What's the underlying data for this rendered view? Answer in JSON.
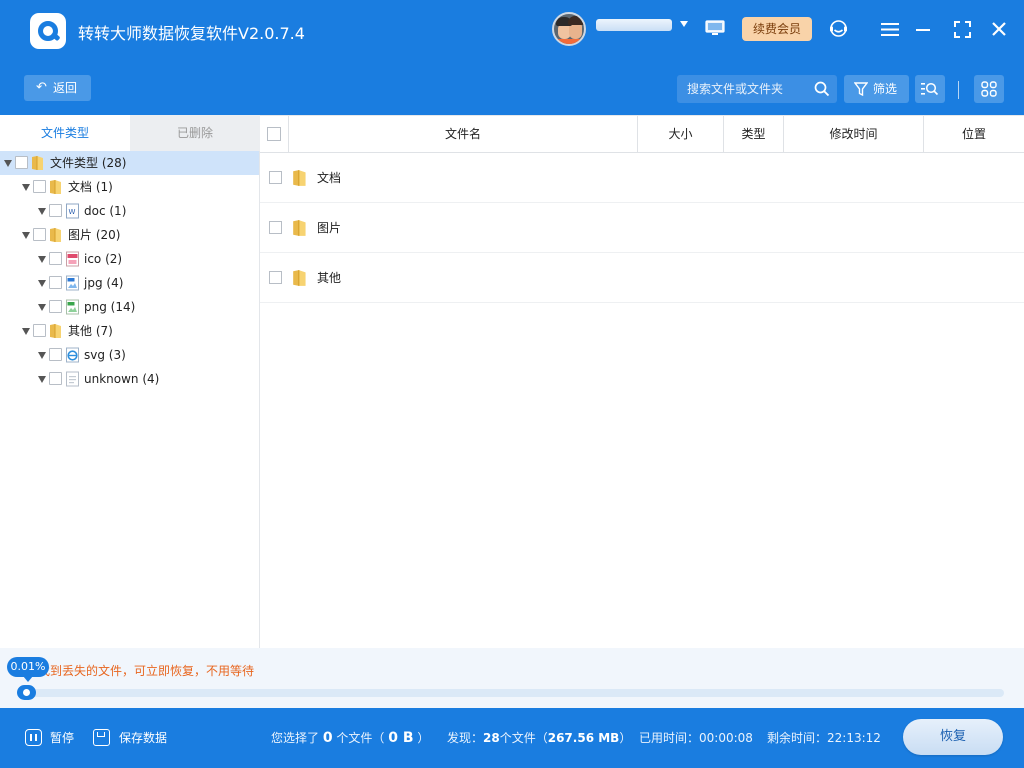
{
  "app": {
    "title": "转转大师数据恢复软件V2.0.7.4",
    "vip_label": "续费会员"
  },
  "toolbar": {
    "back_label": "返回",
    "search_placeholder": "搜索文件或文件夹",
    "filter_label": "筛选"
  },
  "left_panel": {
    "tabs": [
      {
        "label": "文件类型",
        "active": true
      },
      {
        "label": "已删除",
        "active": false
      }
    ],
    "tree": [
      {
        "label": "文件类型 (28)",
        "depth": 0,
        "icon": "folder-icon",
        "selected": true
      },
      {
        "label": "文档 (1)",
        "depth": 1,
        "icon": "folder-icon"
      },
      {
        "label": "doc (1)",
        "depth": 2,
        "icon": "word-doc-icon"
      },
      {
        "label": "图片 (20)",
        "depth": 1,
        "icon": "folder-icon"
      },
      {
        "label": "ico (2)",
        "depth": 2,
        "icon": "ico-file-icon"
      },
      {
        "label": "jpg (4)",
        "depth": 2,
        "icon": "jpg-file-icon"
      },
      {
        "label": "png (14)",
        "depth": 2,
        "icon": "png-file-icon"
      },
      {
        "label": "其他 (7)",
        "depth": 1,
        "icon": "folder-icon"
      },
      {
        "label": "svg (3)",
        "depth": 2,
        "icon": "svg-file-icon"
      },
      {
        "label": "unknown (4)",
        "depth": 2,
        "icon": "unknown-file-icon"
      }
    ]
  },
  "table": {
    "columns": [
      "文件名",
      "大小",
      "类型",
      "修改时间",
      "位置"
    ],
    "rows": [
      {
        "name": "文档"
      },
      {
        "name": "图片"
      },
      {
        "name": "其他"
      }
    ]
  },
  "progress": {
    "percent_label": "0.01%",
    "tip": "找到丢失的文件，可立即恢复，不用等待",
    "fraction": 0.0001
  },
  "bottom": {
    "pause_label": "暂停",
    "save_label": "保存数据",
    "selected_prefix": "您选择了",
    "selected_count": "0",
    "selected_mid": "个文件（",
    "selected_size": "0 B",
    "selected_suffix": "）",
    "found_prefix": "发现：",
    "found_count": "28",
    "found_mid": "个文件（",
    "found_size": "267.56 MB",
    "found_suffix": "）",
    "elapsed_label": "已用时间：",
    "elapsed_value": "00:00:08",
    "remaining_label": "剩余时间：",
    "remaining_value": "22:13:12",
    "recover_label": "恢复"
  },
  "colors": {
    "brand_blue": "#1a7de0",
    "vip_bg": "#f9d3a9",
    "tip_orange": "#e8661f",
    "selected_row": "#cfe3fa"
  }
}
